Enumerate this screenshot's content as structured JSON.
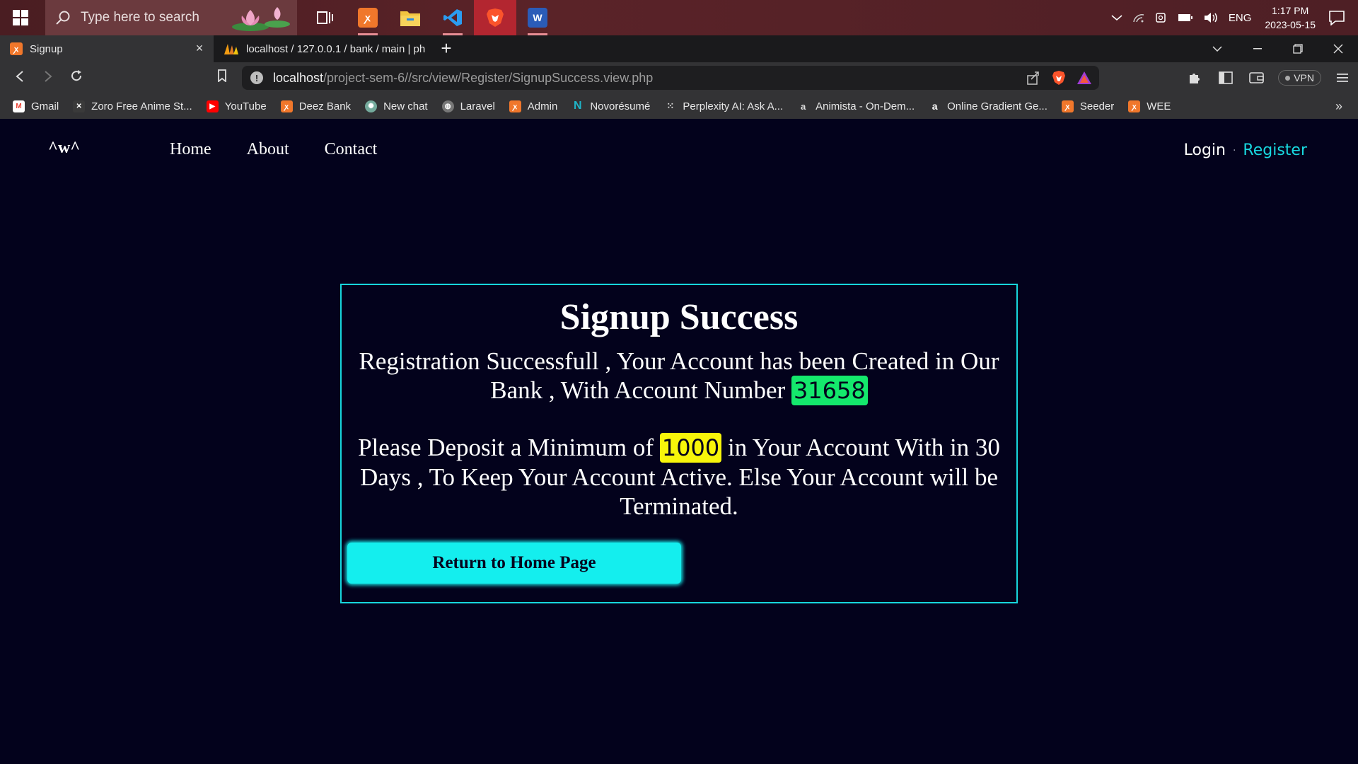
{
  "taskbar": {
    "search_placeholder": "Type here to search",
    "apps": [
      {
        "icon": "task-view-icon"
      },
      {
        "icon": "xampp-icon"
      },
      {
        "icon": "file-explorer-icon"
      },
      {
        "icon": "vscode-icon"
      },
      {
        "icon": "brave-icon"
      },
      {
        "icon": "word-icon",
        "label": "W"
      }
    ],
    "language": "ENG",
    "time": "1:17 PM",
    "date": "2023-05-15"
  },
  "browser": {
    "tabs": [
      {
        "title": "Signup",
        "active": true
      },
      {
        "title": "localhost / 127.0.0.1 / bank / main | ph",
        "active": false
      }
    ],
    "url_host": "localhost",
    "url_path": "/project-sem-6//src/view/Register/SignupSuccess.view.php",
    "vpn_label": "VPN",
    "bookmarks": [
      {
        "label": "Gmail",
        "icon": "gmail-icon",
        "color": "#ea4335"
      },
      {
        "label": "Zoro Free Anime St...",
        "icon": "zoro-icon",
        "color": "#3a3a3a"
      },
      {
        "label": "YouTube",
        "icon": "youtube-icon",
        "color": "#ff0000"
      },
      {
        "label": "Deez Bank",
        "icon": "xampp-icon",
        "color": "#f0772b"
      },
      {
        "label": "New chat",
        "icon": "openai-icon",
        "color": "#74aa9c"
      },
      {
        "label": "Laravel",
        "icon": "globe-icon",
        "color": "#777777"
      },
      {
        "label": "Admin",
        "icon": "xampp-icon",
        "color": "#f0772b"
      },
      {
        "label": "Novorésumé",
        "icon": "novoresume-icon",
        "color": "#1fb5c9"
      },
      {
        "label": "Perplexity AI: Ask A...",
        "icon": "grid-icon",
        "color": "#555555"
      },
      {
        "label": "Animista - On-Dem...",
        "icon": "animista-icon",
        "color": "#444444"
      },
      {
        "label": "Online Gradient Ge...",
        "icon": "gradient-icon",
        "color": "#2a5fd6"
      },
      {
        "label": "Seeder",
        "icon": "xampp-icon",
        "color": "#f0772b"
      },
      {
        "label": "WEE",
        "icon": "xampp-icon",
        "color": "#f0772b"
      }
    ]
  },
  "site": {
    "logo": "^w^",
    "nav": [
      "Home",
      "About",
      "Contact"
    ],
    "login": "Login",
    "separator": "·",
    "register": "Register",
    "accent_color": "#17d6dd"
  },
  "card": {
    "title": "Signup Success",
    "line1_before": "Registration Successfull , Your Account has been Created in Our Bank , With Account Number ",
    "account_number": "31658",
    "line2_before": "Please Deposit a Minimum of ",
    "minimum_amount": "1000",
    "line2_after": " in Your Account With in 30 Days , To Keep Your Account Active. Else Your Account will be Terminated.",
    "button_label": "Return to Home Page"
  }
}
